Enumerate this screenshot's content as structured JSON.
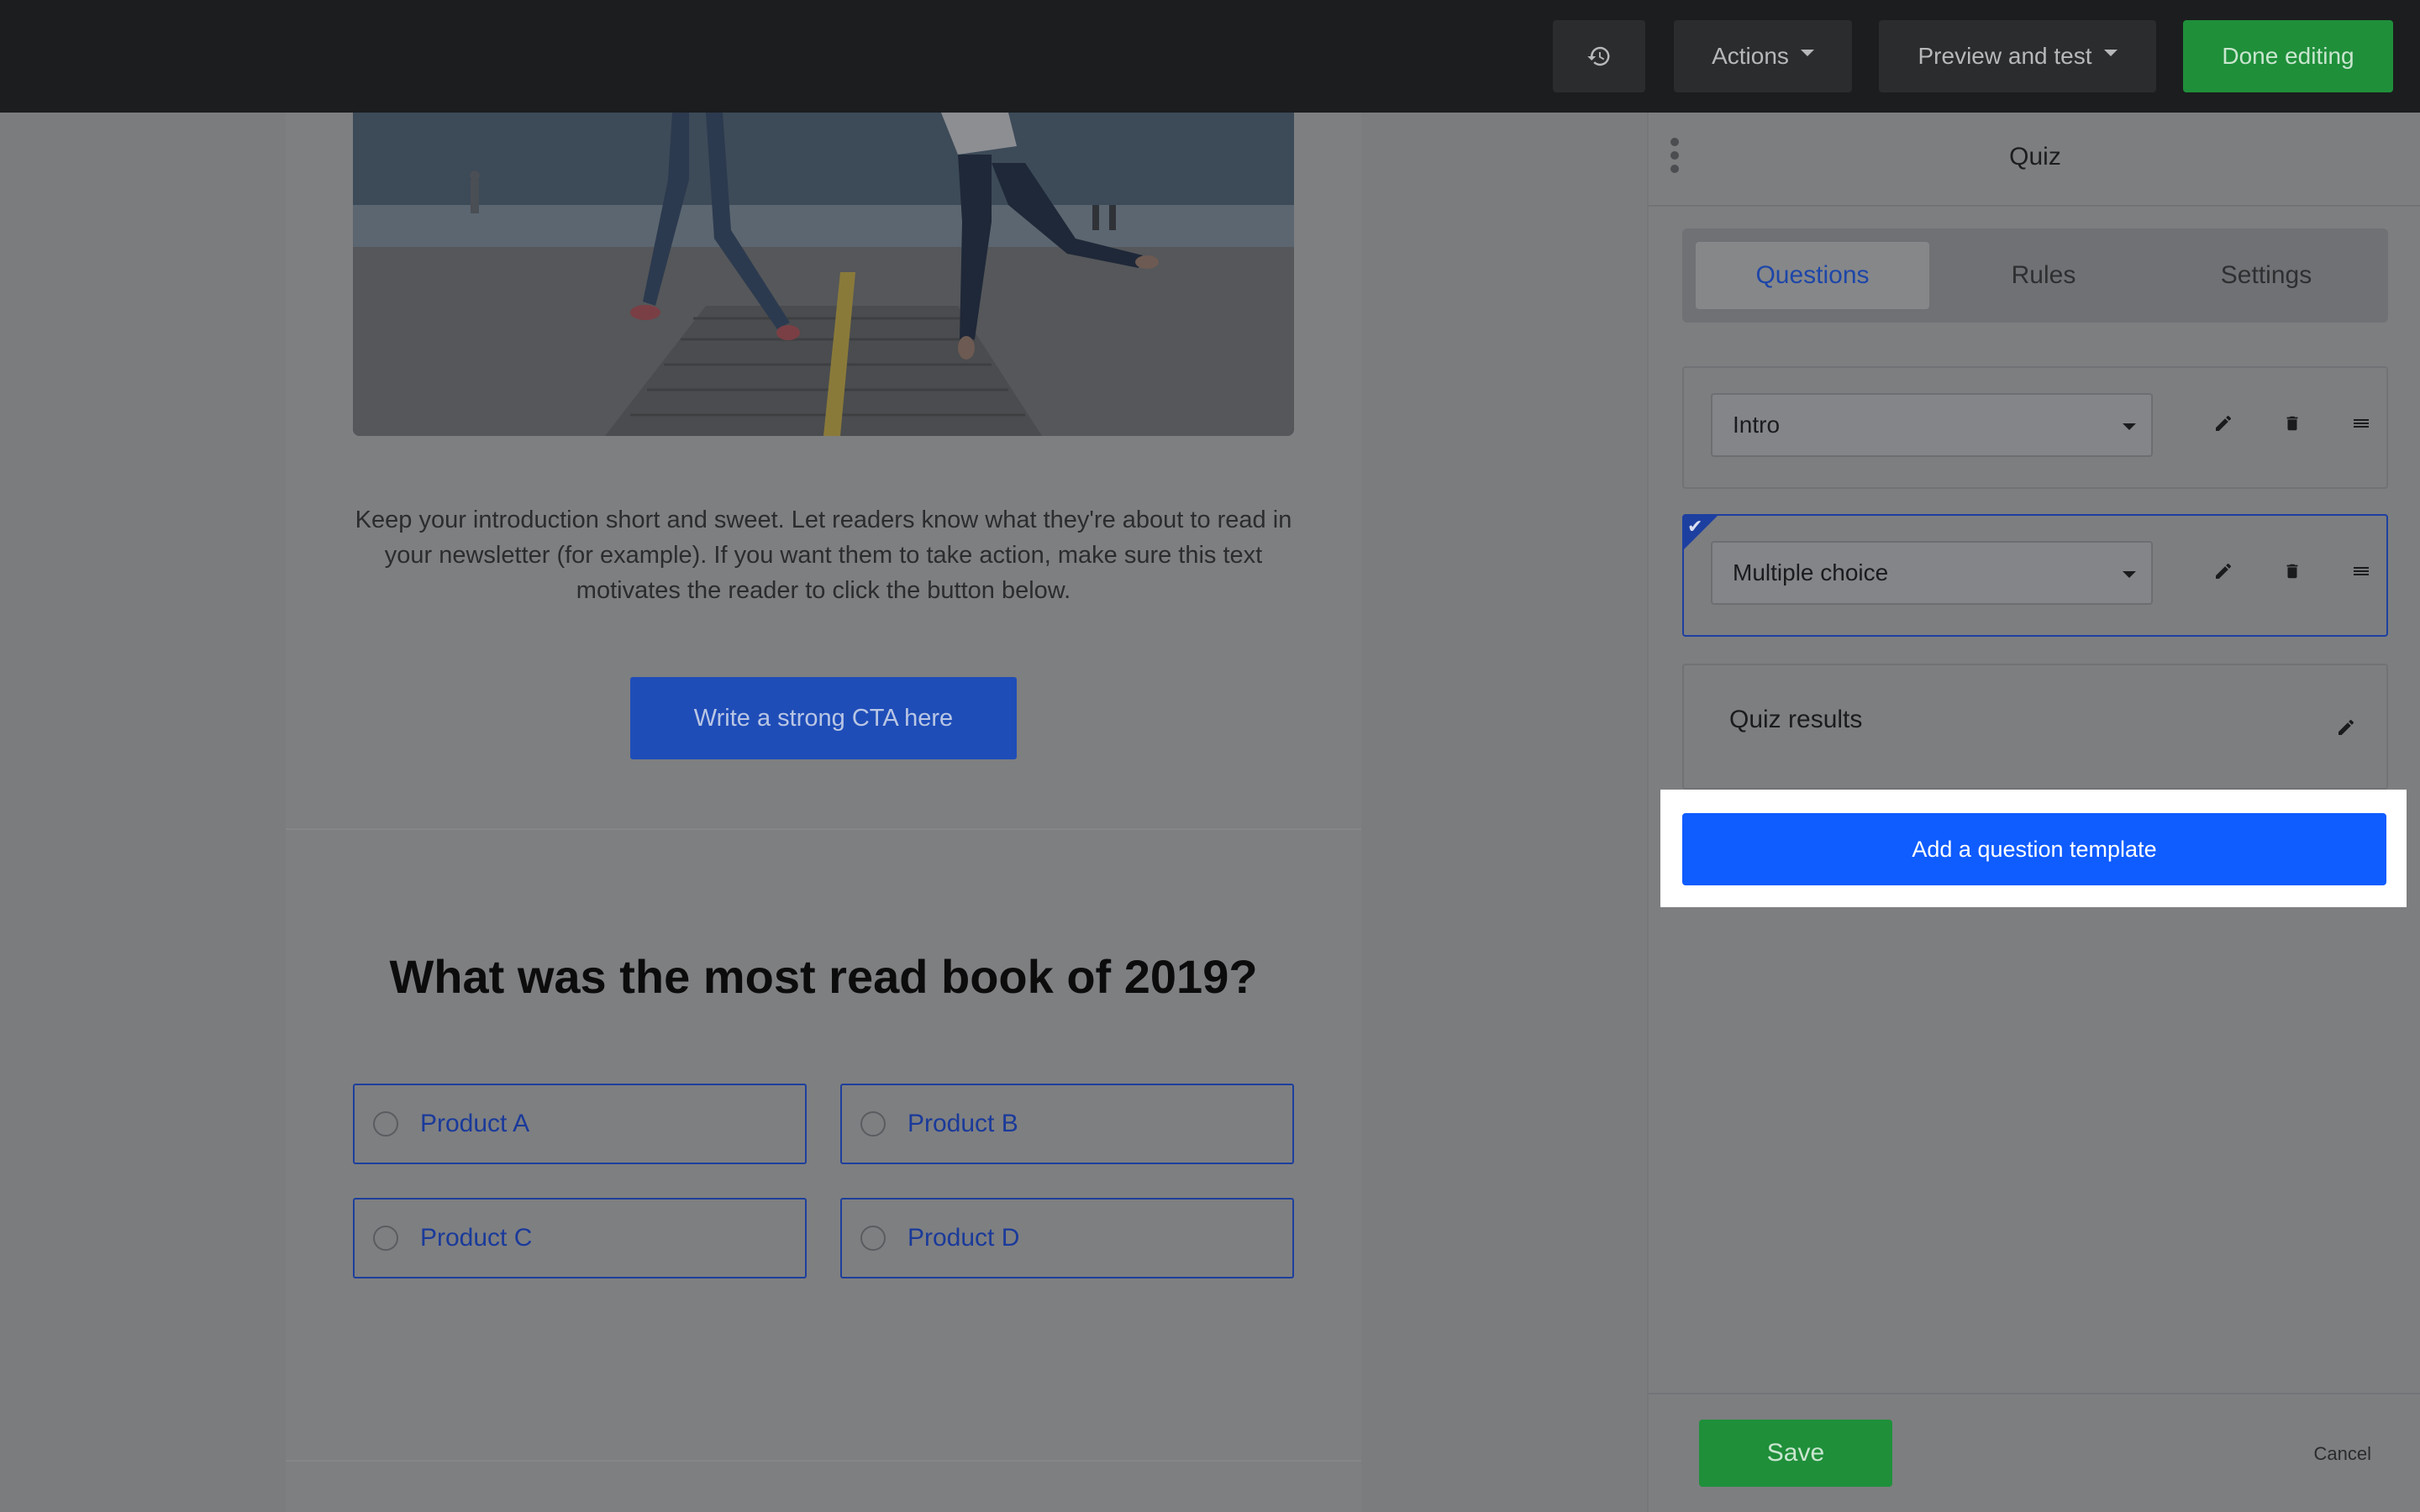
{
  "topbar": {
    "history_icon": "history-icon",
    "actions_label": "Actions",
    "preview_label": "Preview and test",
    "done_label": "Done editing"
  },
  "email": {
    "intro": "Keep your introduction short and sweet. Let readers know what they're about to read in your newsletter (for example). If you want them to take action, make sure this text motivates the reader to click the button below.",
    "cta": "Write a strong CTA here",
    "question": "What was the most read book of 2019?",
    "options": [
      "Product A",
      "Product B",
      "Product C",
      "Product D"
    ]
  },
  "panel": {
    "title": "Quiz",
    "tabs": [
      "Questions",
      "Rules",
      "Settings"
    ],
    "active_tab": "Questions",
    "cards": [
      {
        "type": "Intro"
      },
      {
        "type": "Multiple choice",
        "selected": true
      }
    ],
    "results_label": "Quiz results",
    "add_template_label": "Add a question template",
    "save_label": "Save",
    "cancel_label": "Cancel"
  },
  "colors": {
    "primary": "#0f5cff",
    "success": "#1f8f3a",
    "dark": "#1c1d1f"
  }
}
